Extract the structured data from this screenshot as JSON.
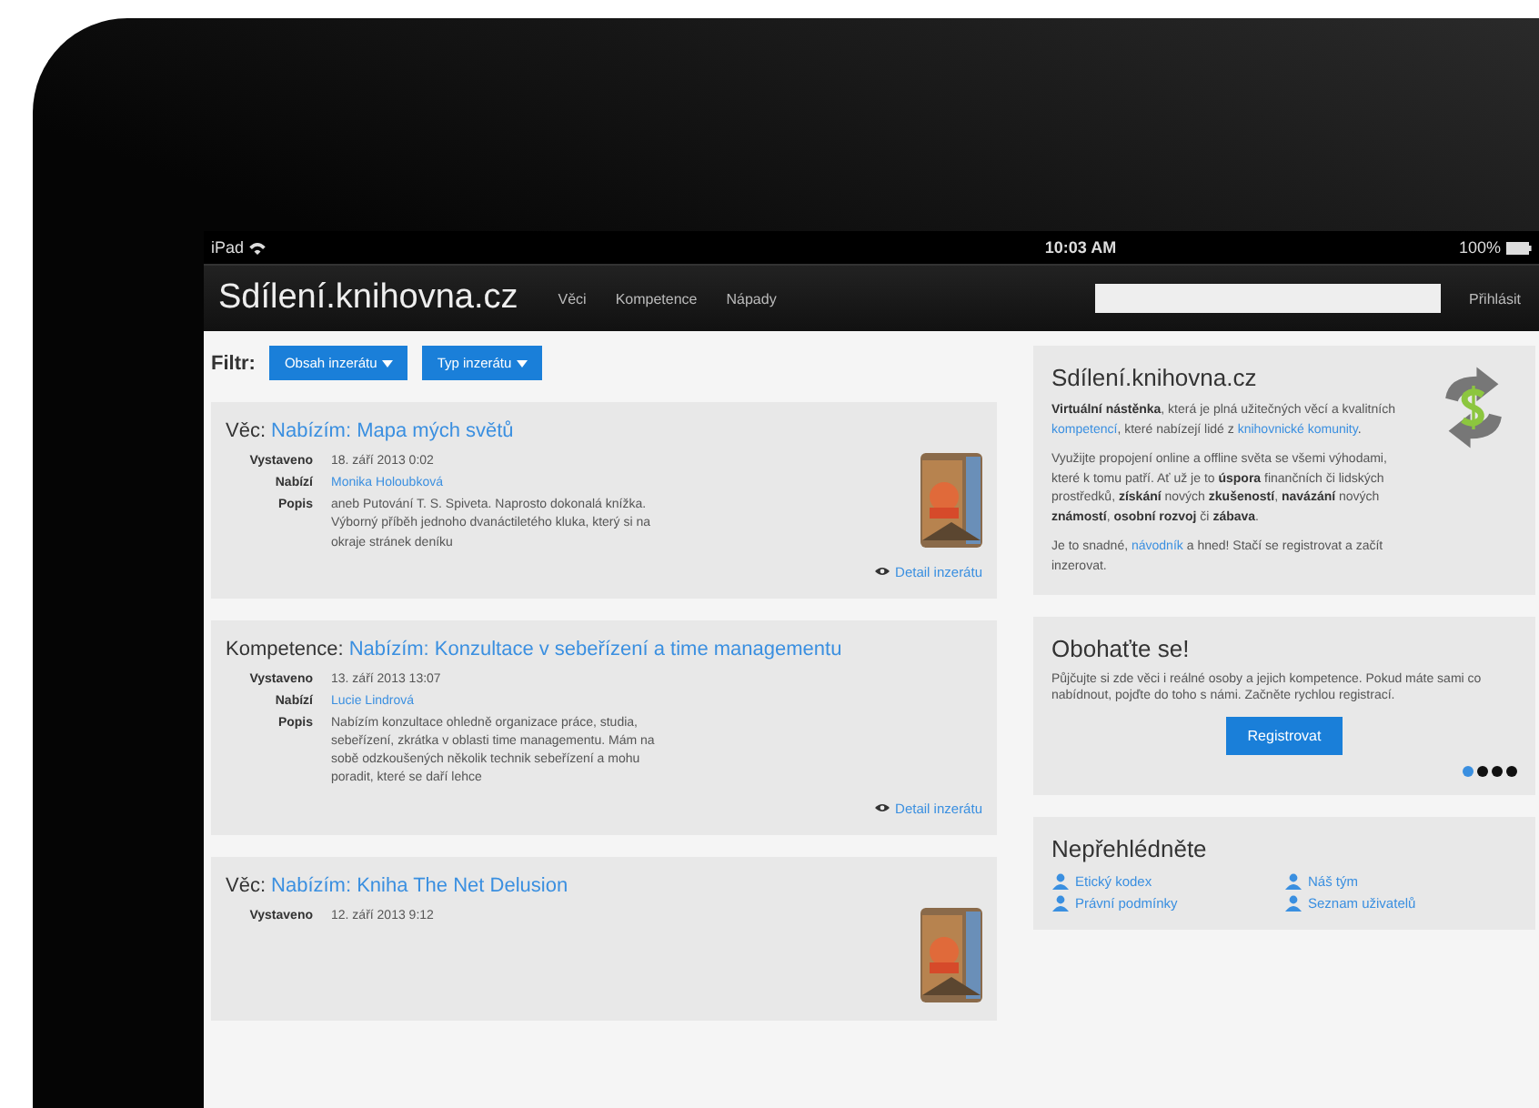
{
  "status_bar": {
    "device": "iPad",
    "time": "10:03 AM",
    "battery": "100%"
  },
  "nav": {
    "brand": "Sdílení.knihovna.cz",
    "links": [
      "Věci",
      "Kompetence",
      "Nápady"
    ],
    "login": "Přihlásit"
  },
  "filter": {
    "label": "Filtr:",
    "buttons": [
      "Obsah inzerátu",
      "Typ inzerátu"
    ]
  },
  "listings": [
    {
      "type": "Věc:",
      "title": "Nabízím: Mapa mých světů",
      "fields": [
        {
          "label": "Vystaveno",
          "value": "18. září 2013 0:02",
          "kind": "text"
        },
        {
          "label": "Nabízí",
          "value": "Monika Holoubková",
          "kind": "link"
        },
        {
          "label": "Popis",
          "value": "aneb Putování T. S. Spiveta. Naprosto dokonalá knížka. Výborný příběh jednoho dvanáctiletého kluka, který si na okraje stránek deníku",
          "kind": "text"
        }
      ],
      "image": {
        "kind": "picture"
      },
      "detail": "Detail inzerátu"
    },
    {
      "type": "Kompetence:",
      "title": "Nabízím: Konzultace v sebeřízení a time managementu",
      "fields": [
        {
          "label": "Vystaveno",
          "value": "13. září 2013 13:07",
          "kind": "text"
        },
        {
          "label": "Nabízí",
          "value": "Lucie Lindrová",
          "kind": "link"
        },
        {
          "label": "Popis",
          "value": "Nabízím konzultace ohledně organizace práce, studia, sebeřízení, zkrátka v oblasti time managementu. Mám na sobě odzkoušených několik technik sebeřízení a mohu poradit, které se daří lehce",
          "kind": "text"
        }
      ],
      "detail": "Detail inzerátu"
    },
    {
      "type": "Věc:",
      "title": "Nabízím: Kniha The Net Delusion",
      "fields": [
        {
          "label": "Vystaveno",
          "value": "12. září 2013 9:12",
          "kind": "text"
        }
      ],
      "image": {
        "kind": "picture"
      }
    }
  ],
  "about": {
    "title": "Sdílení.knihovna.cz",
    "paragraphs": [
      [
        {
          "kind": "bold",
          "text": "Virtuální nástěnka"
        },
        {
          "kind": "text",
          "text": ", která je plná užitečných věcí a kvalitních "
        },
        {
          "kind": "link",
          "text": "kompetencí"
        },
        {
          "kind": "text",
          "text": ", které nabízejí lidé z "
        },
        {
          "kind": "link",
          "text": "knihovnické komunity"
        },
        {
          "kind": "text",
          "text": "."
        }
      ],
      [
        {
          "kind": "text",
          "text": "Využijte propojení online a offline světa se všemi výhodami, které k tomu patří. Ať už je to "
        },
        {
          "kind": "bold",
          "text": "úspora"
        },
        {
          "kind": "text",
          "text": " finančních či lidských prostředků, "
        },
        {
          "kind": "bold",
          "text": "získání"
        },
        {
          "kind": "text",
          "text": " nových "
        },
        {
          "kind": "bold",
          "text": "zkušeností"
        },
        {
          "kind": "text",
          "text": ", "
        },
        {
          "kind": "bold",
          "text": "navázání"
        },
        {
          "kind": "text",
          "text": " nových "
        },
        {
          "kind": "bold",
          "text": "známostí"
        },
        {
          "kind": "text",
          "text": ", "
        },
        {
          "kind": "bold",
          "text": "osobní rozvoj"
        },
        {
          "kind": "text",
          "text": " či "
        },
        {
          "kind": "bold",
          "text": "zábava"
        },
        {
          "kind": "text",
          "text": "."
        }
      ],
      [
        {
          "kind": "text",
          "text": "Je to snadné, "
        },
        {
          "kind": "link",
          "text": "návodník"
        },
        {
          "kind": "text",
          "text": " a hned! Stačí se registrovat a začít inzerovat."
        }
      ]
    ]
  },
  "promo": {
    "title": "Obohaťte se!",
    "text": "Půjčujte si zde věci i reálné osoby a jejich kompetence. Pokud máte sami co nabídnout, pojďte do toho s námi. Začněte rychlou registrací.",
    "button": "Registrovat",
    "dots": [
      {
        "selected": true
      },
      {
        "selected": false
      },
      {
        "selected": false
      },
      {
        "selected": false
      }
    ]
  },
  "links_panel": {
    "title": "Nepřehlédněte",
    "links": [
      "Etický kodex",
      "Náš tým",
      "Právní podmínky",
      "Seznam uživatelů"
    ]
  }
}
